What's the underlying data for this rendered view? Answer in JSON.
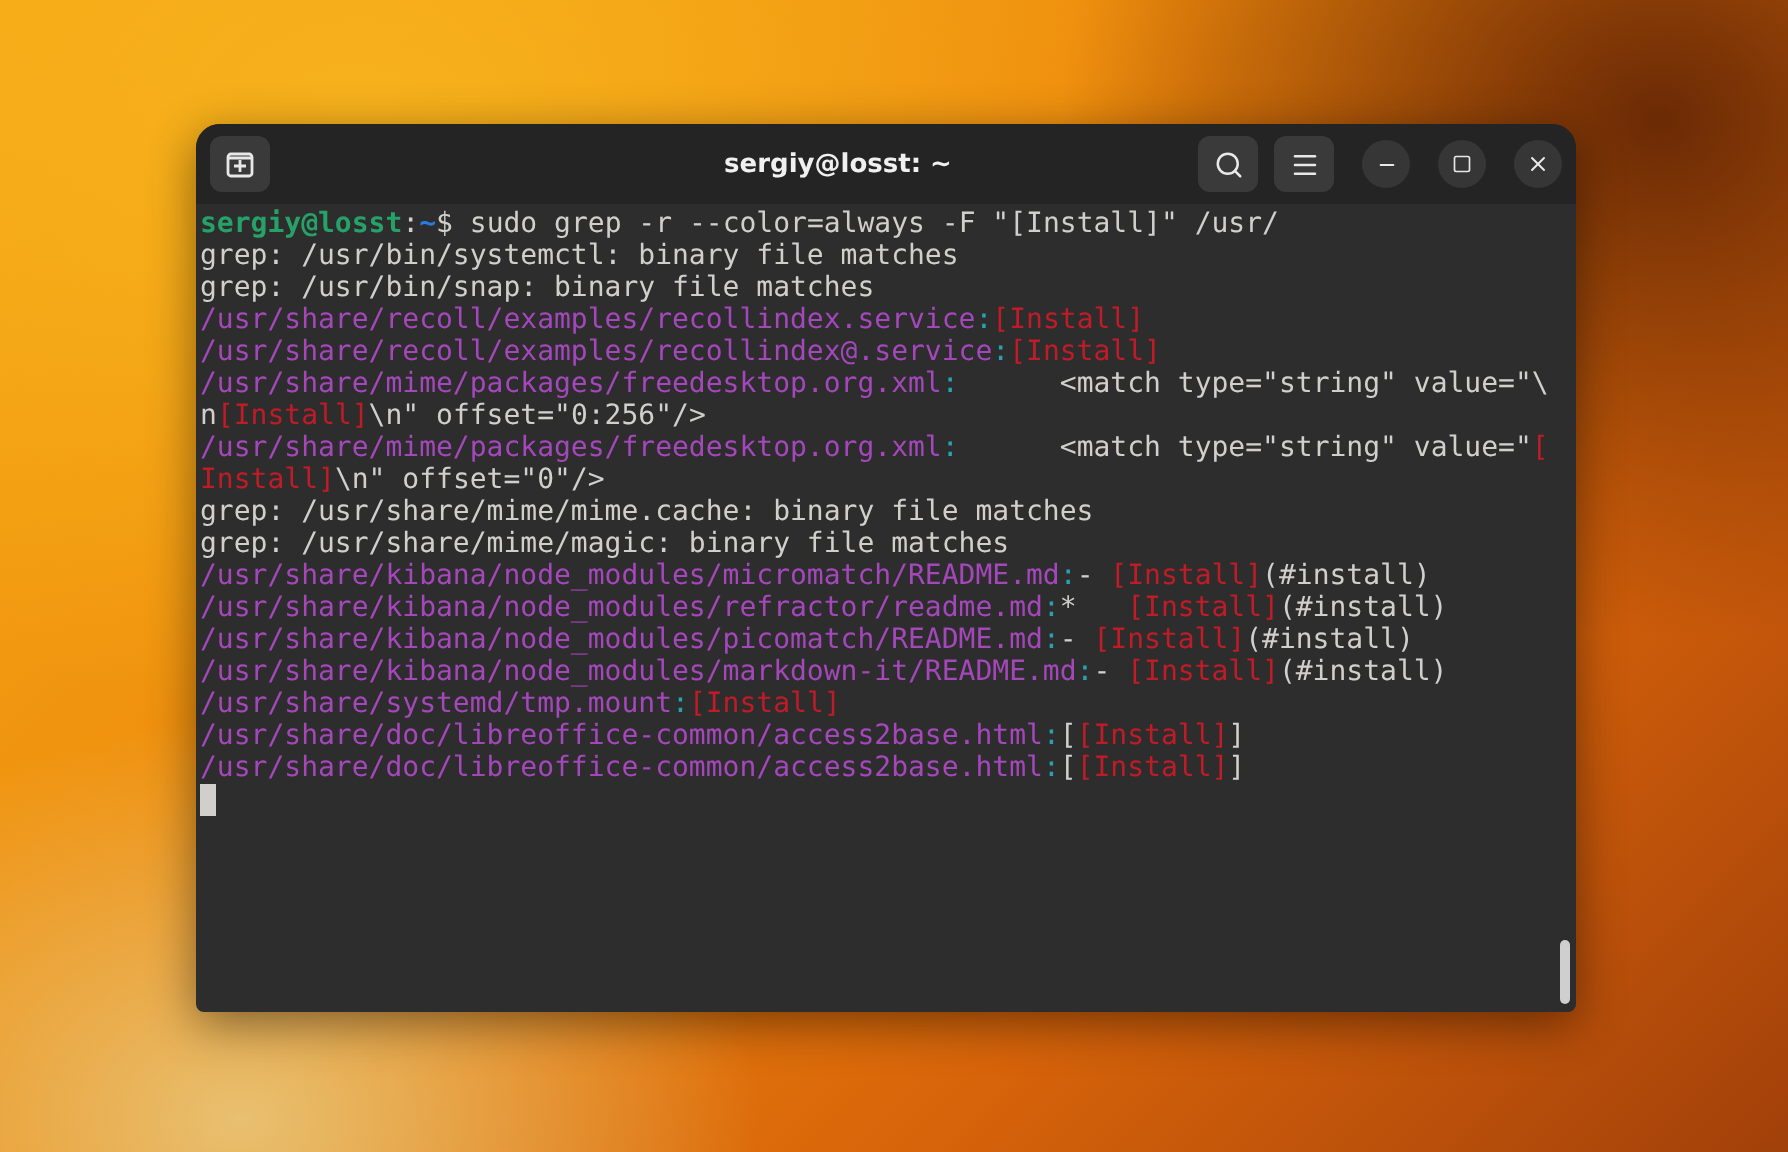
{
  "window": {
    "title": "sergiy@losst: ~"
  },
  "terminal": {
    "lines": [
      {
        "segments": [
          {
            "kind": "user",
            "text": "sergiy@losst"
          },
          {
            "kind": "text",
            "text": ":"
          },
          {
            "kind": "cwd",
            "text": "~"
          },
          {
            "kind": "text",
            "text": "$ sudo grep -r --color=always -F \"[Install]\" /usr/"
          }
        ]
      },
      {
        "segments": [
          {
            "kind": "text",
            "text": "grep: /usr/bin/systemctl: binary file matches"
          }
        ]
      },
      {
        "segments": [
          {
            "kind": "text",
            "text": "grep: /usr/bin/snap: binary file matches"
          }
        ]
      },
      {
        "segments": [
          {
            "kind": "path",
            "text": "/usr/share/recoll/examples/recollindex.service"
          },
          {
            "kind": "sep",
            "text": ":"
          },
          {
            "kind": "match",
            "text": "[Install]"
          }
        ]
      },
      {
        "segments": [
          {
            "kind": "path",
            "text": "/usr/share/recoll/examples/recollindex@.service"
          },
          {
            "kind": "sep",
            "text": ":"
          },
          {
            "kind": "match",
            "text": "[Install]"
          }
        ]
      },
      {
        "segments": [
          {
            "kind": "path",
            "text": "/usr/share/mime/packages/freedesktop.org.xml"
          },
          {
            "kind": "sep",
            "text": ":"
          },
          {
            "kind": "text",
            "text": "      <match type=\"string\" value=\"\\"
          }
        ]
      },
      {
        "segments": [
          {
            "kind": "text",
            "text": "n"
          },
          {
            "kind": "match",
            "text": "[Install]"
          },
          {
            "kind": "text",
            "text": "\\n\" offset=\"0:256\"/>"
          }
        ]
      },
      {
        "segments": [
          {
            "kind": "path",
            "text": "/usr/share/mime/packages/freedesktop.org.xml"
          },
          {
            "kind": "sep",
            "text": ":"
          },
          {
            "kind": "text",
            "text": "      <match type=\"string\" value=\""
          },
          {
            "kind": "match",
            "text": "["
          }
        ]
      },
      {
        "segments": [
          {
            "kind": "match",
            "text": "Install]"
          },
          {
            "kind": "text",
            "text": "\\n\" offset=\"0\"/>"
          }
        ]
      },
      {
        "segments": [
          {
            "kind": "text",
            "text": "grep: /usr/share/mime/mime.cache: binary file matches"
          }
        ]
      },
      {
        "segments": [
          {
            "kind": "text",
            "text": "grep: /usr/share/mime/magic: binary file matches"
          }
        ]
      },
      {
        "segments": [
          {
            "kind": "path",
            "text": "/usr/share/kibana/node_modules/micromatch/README.md"
          },
          {
            "kind": "sep",
            "text": ":"
          },
          {
            "kind": "text",
            "text": "- "
          },
          {
            "kind": "match",
            "text": "[Install]"
          },
          {
            "kind": "text",
            "text": "(#install)"
          }
        ]
      },
      {
        "segments": [
          {
            "kind": "path",
            "text": "/usr/share/kibana/node_modules/refractor/readme.md"
          },
          {
            "kind": "sep",
            "text": ":"
          },
          {
            "kind": "text",
            "text": "*   "
          },
          {
            "kind": "match",
            "text": "[Install]"
          },
          {
            "kind": "text",
            "text": "(#install)"
          }
        ]
      },
      {
        "segments": [
          {
            "kind": "path",
            "text": "/usr/share/kibana/node_modules/picomatch/README.md"
          },
          {
            "kind": "sep",
            "text": ":"
          },
          {
            "kind": "text",
            "text": "- "
          },
          {
            "kind": "match",
            "text": "[Install]"
          },
          {
            "kind": "text",
            "text": "(#install)"
          }
        ]
      },
      {
        "segments": [
          {
            "kind": "path",
            "text": "/usr/share/kibana/node_modules/markdown-it/README.md"
          },
          {
            "kind": "sep",
            "text": ":"
          },
          {
            "kind": "text",
            "text": "- "
          },
          {
            "kind": "match",
            "text": "[Install]"
          },
          {
            "kind": "text",
            "text": "(#install)"
          }
        ]
      },
      {
        "segments": [
          {
            "kind": "path",
            "text": "/usr/share/systemd/tmp.mount"
          },
          {
            "kind": "sep",
            "text": ":"
          },
          {
            "kind": "match",
            "text": "[Install]"
          }
        ]
      },
      {
        "segments": [
          {
            "kind": "path",
            "text": "/usr/share/doc/libreoffice-common/access2base.html"
          },
          {
            "kind": "sep",
            "text": ":"
          },
          {
            "kind": "text",
            "text": "["
          },
          {
            "kind": "match",
            "text": "[Install]"
          },
          {
            "kind": "text",
            "text": "]"
          }
        ]
      },
      {
        "segments": [
          {
            "kind": "path",
            "text": "/usr/share/doc/libreoffice-common/access2base.html"
          },
          {
            "kind": "sep",
            "text": ":"
          },
          {
            "kind": "text",
            "text": "["
          },
          {
            "kind": "match",
            "text": "[Install]"
          },
          {
            "kind": "text",
            "text": "]"
          }
        ]
      }
    ]
  }
}
